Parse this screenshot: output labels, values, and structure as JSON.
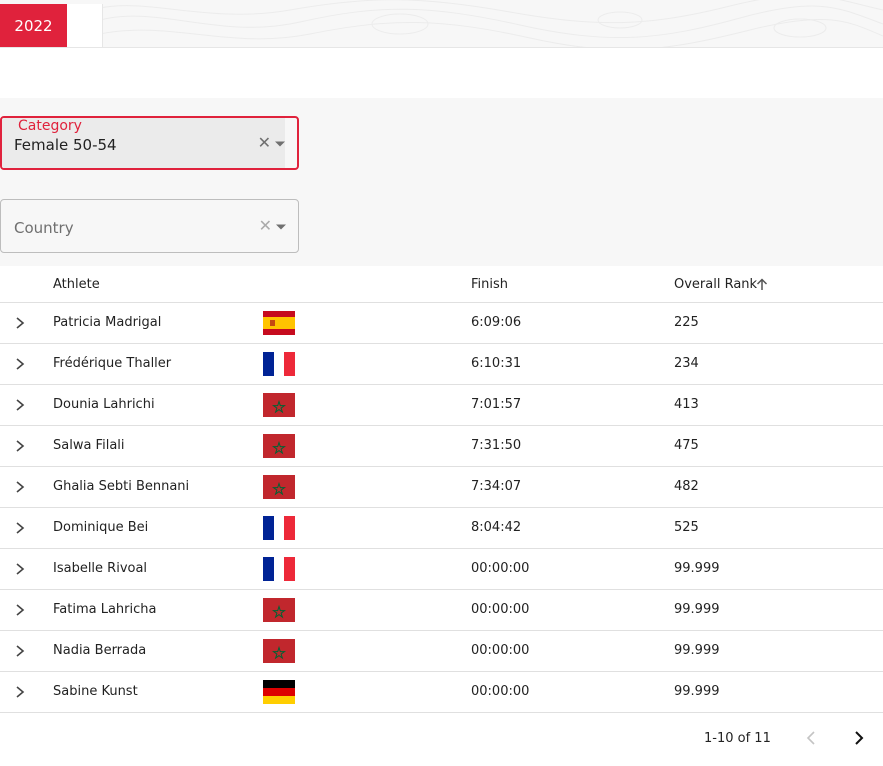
{
  "year_tab": "2022",
  "filters": {
    "category": {
      "label": "Category",
      "value": "Female 50-54",
      "clear": "✕"
    },
    "country": {
      "placeholder": "Country",
      "clear": "✕"
    }
  },
  "table": {
    "columns": {
      "athlete": "Athlete",
      "finish": "Finish",
      "rank": "Overall Rank"
    },
    "sort": {
      "column": "rank",
      "direction": "asc",
      "icon": "arrow-up-icon"
    },
    "rows": [
      {
        "name": "Patricia Madrigal",
        "country": "spain",
        "finish": "6:09:06",
        "rank": "225"
      },
      {
        "name": "Frédérique Thaller",
        "country": "france",
        "finish": "6:10:31",
        "rank": "234"
      },
      {
        "name": "Dounia Lahrichi",
        "country": "morocco",
        "finish": "7:01:57",
        "rank": "413"
      },
      {
        "name": "Salwa Filali",
        "country": "morocco",
        "finish": "7:31:50",
        "rank": "475"
      },
      {
        "name": "Ghalia Sebti Bennani",
        "country": "morocco",
        "finish": "7:34:07",
        "rank": "482"
      },
      {
        "name": "Dominique Bei",
        "country": "france",
        "finish": "8:04:42",
        "rank": "525"
      },
      {
        "name": "Isabelle Rivoal",
        "country": "france",
        "finish": "00:00:00",
        "rank": "99.999"
      },
      {
        "name": "Fatima Lahricha",
        "country": "morocco",
        "finish": "00:00:00",
        "rank": "99.999"
      },
      {
        "name": "Nadia Berrada",
        "country": "morocco",
        "finish": "00:00:00",
        "rank": "99.999"
      },
      {
        "name": "Sabine Kunst",
        "country": "germany",
        "finish": "00:00:00",
        "rank": "99.999"
      }
    ]
  },
  "pagination": {
    "range": "1-10 of 11",
    "prev_enabled": false,
    "next_enabled": true
  },
  "colors": {
    "accent": "#e0223c",
    "panel_bg": "#f7f7f7",
    "row_border": "#e0e0e0"
  }
}
